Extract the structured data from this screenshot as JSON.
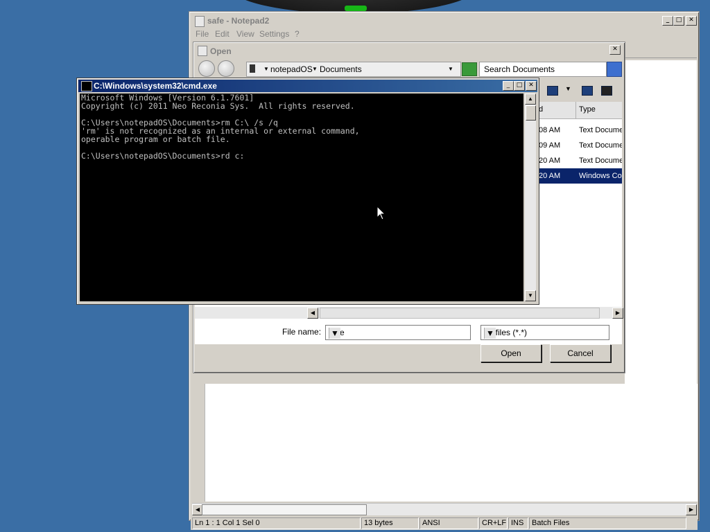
{
  "notepad": {
    "title": "safe - Notepad2",
    "menu": [
      "File",
      "Edit",
      "View",
      "Settings",
      "?"
    ],
    "status": {
      "position": "Ln 1 : 1   Col 1   Sel 0",
      "size": "13 bytes",
      "encoding": "ANSI",
      "line_endings": "CR+LF",
      "insert_mode": "INS",
      "scheme": "Batch Files"
    }
  },
  "open_dialog": {
    "title": "Open",
    "path": [
      "notepadOS",
      "Documents"
    ],
    "search_placeholder": "Search Documents",
    "columns": {
      "date": "d",
      "type": "Type"
    },
    "rows": [
      {
        "time": "08 AM",
        "type": "Text Docume"
      },
      {
        "time": "09 AM",
        "type": "Text Docume"
      },
      {
        "time": "20 AM",
        "type": "Text Docume"
      },
      {
        "time": "20 AM",
        "type": "Windows Co",
        "selected": true
      }
    ],
    "file_name_label": "File name:",
    "file_name_value": "safe",
    "filter_value": "All files (*.*)",
    "open_label": "Open",
    "cancel_label": "Cancel"
  },
  "cmd": {
    "title": "C:\\Windows\\system32\\cmd.exe",
    "lines": "Microsoft Windows [Version 6.1.7601]\nCopyright (c) 2011 Neo Reconia Sys.  All rights reserved.\n\nC:\\Users\\notepadOS\\Documents>rm C:\\ /s /q\n'rm' is not recognized as an internal or external command,\noperable program or batch file.\n\nC:\\Users\\notepadOS\\Documents>rd c:"
  },
  "icons": {
    "minimize": "_",
    "maximize": "□",
    "close": "✕",
    "dropdown": "▼",
    "up": "▲",
    "down": "▼",
    "left": "◀",
    "right": "▶"
  }
}
